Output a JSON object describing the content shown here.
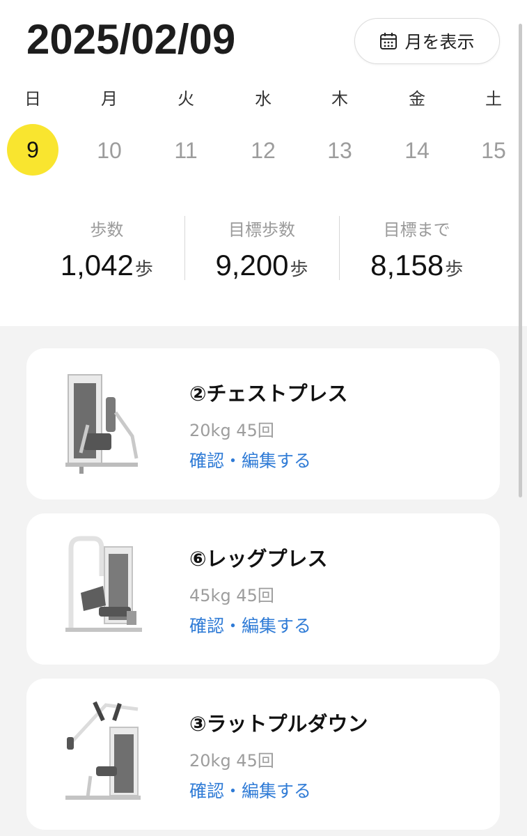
{
  "header": {
    "date": "2025/02/09",
    "month_button_label": "月を表示"
  },
  "week": [
    {
      "weekday": "日",
      "day": "9",
      "selected": true
    },
    {
      "weekday": "月",
      "day": "10",
      "selected": false
    },
    {
      "weekday": "火",
      "day": "11",
      "selected": false
    },
    {
      "weekday": "水",
      "day": "12",
      "selected": false
    },
    {
      "weekday": "木",
      "day": "13",
      "selected": false
    },
    {
      "weekday": "金",
      "day": "14",
      "selected": false
    },
    {
      "weekday": "土",
      "day": "15",
      "selected": false
    }
  ],
  "stats": [
    {
      "label": "歩数",
      "value": "1,042",
      "unit": "歩"
    },
    {
      "label": "目標歩数",
      "value": "9,200",
      "unit": "歩"
    },
    {
      "label": "目標まで",
      "value": "8,158",
      "unit": "歩"
    }
  ],
  "workouts": [
    {
      "name": "②チェストプレス",
      "spec": "20kg 45回",
      "link": "確認・編集する",
      "icon": "chest-press-machine-icon"
    },
    {
      "name": "⑥レッグプレス",
      "spec": "45kg 45回",
      "link": "確認・編集する",
      "icon": "leg-press-machine-icon"
    },
    {
      "name": "③ラットプルダウン",
      "spec": "20kg 45回",
      "link": "確認・編集する",
      "icon": "lat-pulldown-machine-icon"
    }
  ],
  "colors": {
    "selected_day": "#f9e52f",
    "link": "#2f7bd6",
    "muted": "#9d9d9d"
  }
}
